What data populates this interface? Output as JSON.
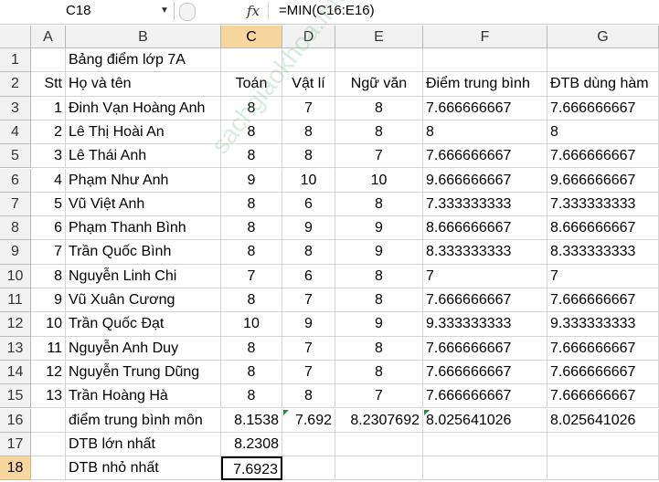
{
  "formula_bar": {
    "name_box": "C18",
    "fx_label": "fx",
    "formula": "=MIN(C16:E16)"
  },
  "columns": [
    "A",
    "B",
    "C",
    "D",
    "E",
    "F",
    "G"
  ],
  "rows": [
    [
      "",
      "Bảng điểm lớp 7A",
      "",
      "",
      "",
      "",
      ""
    ],
    [
      "Stt",
      "Họ và tên",
      "Toán",
      "Vật lí",
      "Ngữ văn",
      "Điểm trung bình",
      "ĐTB dùng hàm"
    ],
    [
      "1",
      "Đinh Vạn Hoàng Anh",
      "8",
      "7",
      "8",
      "7.666666667",
      "7.666666667"
    ],
    [
      "2",
      "Lê Thị Hoài An",
      "8",
      "8",
      "8",
      "8",
      "8"
    ],
    [
      "3",
      "Lê Thái Anh",
      "8",
      "8",
      "7",
      "7.666666667",
      "7.666666667"
    ],
    [
      "4",
      "Phạm Như Anh",
      "9",
      "10",
      "10",
      "9.666666667",
      "9.666666667"
    ],
    [
      "5",
      "Vũ Việt Anh",
      "8",
      "6",
      "8",
      "7.333333333",
      "7.333333333"
    ],
    [
      "6",
      "Phạm Thanh Bình",
      "8",
      "9",
      "9",
      "8.666666667",
      "8.666666667"
    ],
    [
      "7",
      "Trần Quốc Bình",
      "8",
      "8",
      "9",
      "8.333333333",
      "8.333333333"
    ],
    [
      "8",
      "Nguyễn Linh Chi",
      "7",
      "6",
      "8",
      "7",
      "7"
    ],
    [
      "9",
      "Vũ Xuân Cương",
      "8",
      "7",
      "8",
      "7.666666667",
      "7.666666667"
    ],
    [
      "10",
      "Trần Quốc Đạt",
      "10",
      "9",
      "9",
      "9.333333333",
      "9.333333333"
    ],
    [
      "11",
      "Nguyễn Anh Duy",
      "8",
      "7",
      "8",
      "7.666666667",
      "7.666666667"
    ],
    [
      "12",
      "Nguyễn Trung Dũng",
      "8",
      "7",
      "8",
      "7.666666667",
      "7.666666667"
    ],
    [
      "13",
      "Trần Hoàng Hà",
      "8",
      "8",
      "7",
      "7.666666667",
      "7.666666667"
    ],
    [
      "",
      "điểm trung bình môn",
      "8.1538",
      "7.692",
      "8.2307692",
      "8.025641026",
      "8.025641026"
    ],
    [
      "",
      "DTB lớn nhất",
      "8.2308",
      "",
      "",
      "",
      ""
    ],
    [
      "",
      "DTB nhỏ nhất",
      "7.6923",
      "",
      "",
      "",
      ""
    ]
  ],
  "watermark": "sachgiaokhoa.info",
  "colors": {
    "selected_header": "#f8d79e",
    "error_indicator": "#1e8e3e",
    "gridline": "#d4d4d4"
  }
}
